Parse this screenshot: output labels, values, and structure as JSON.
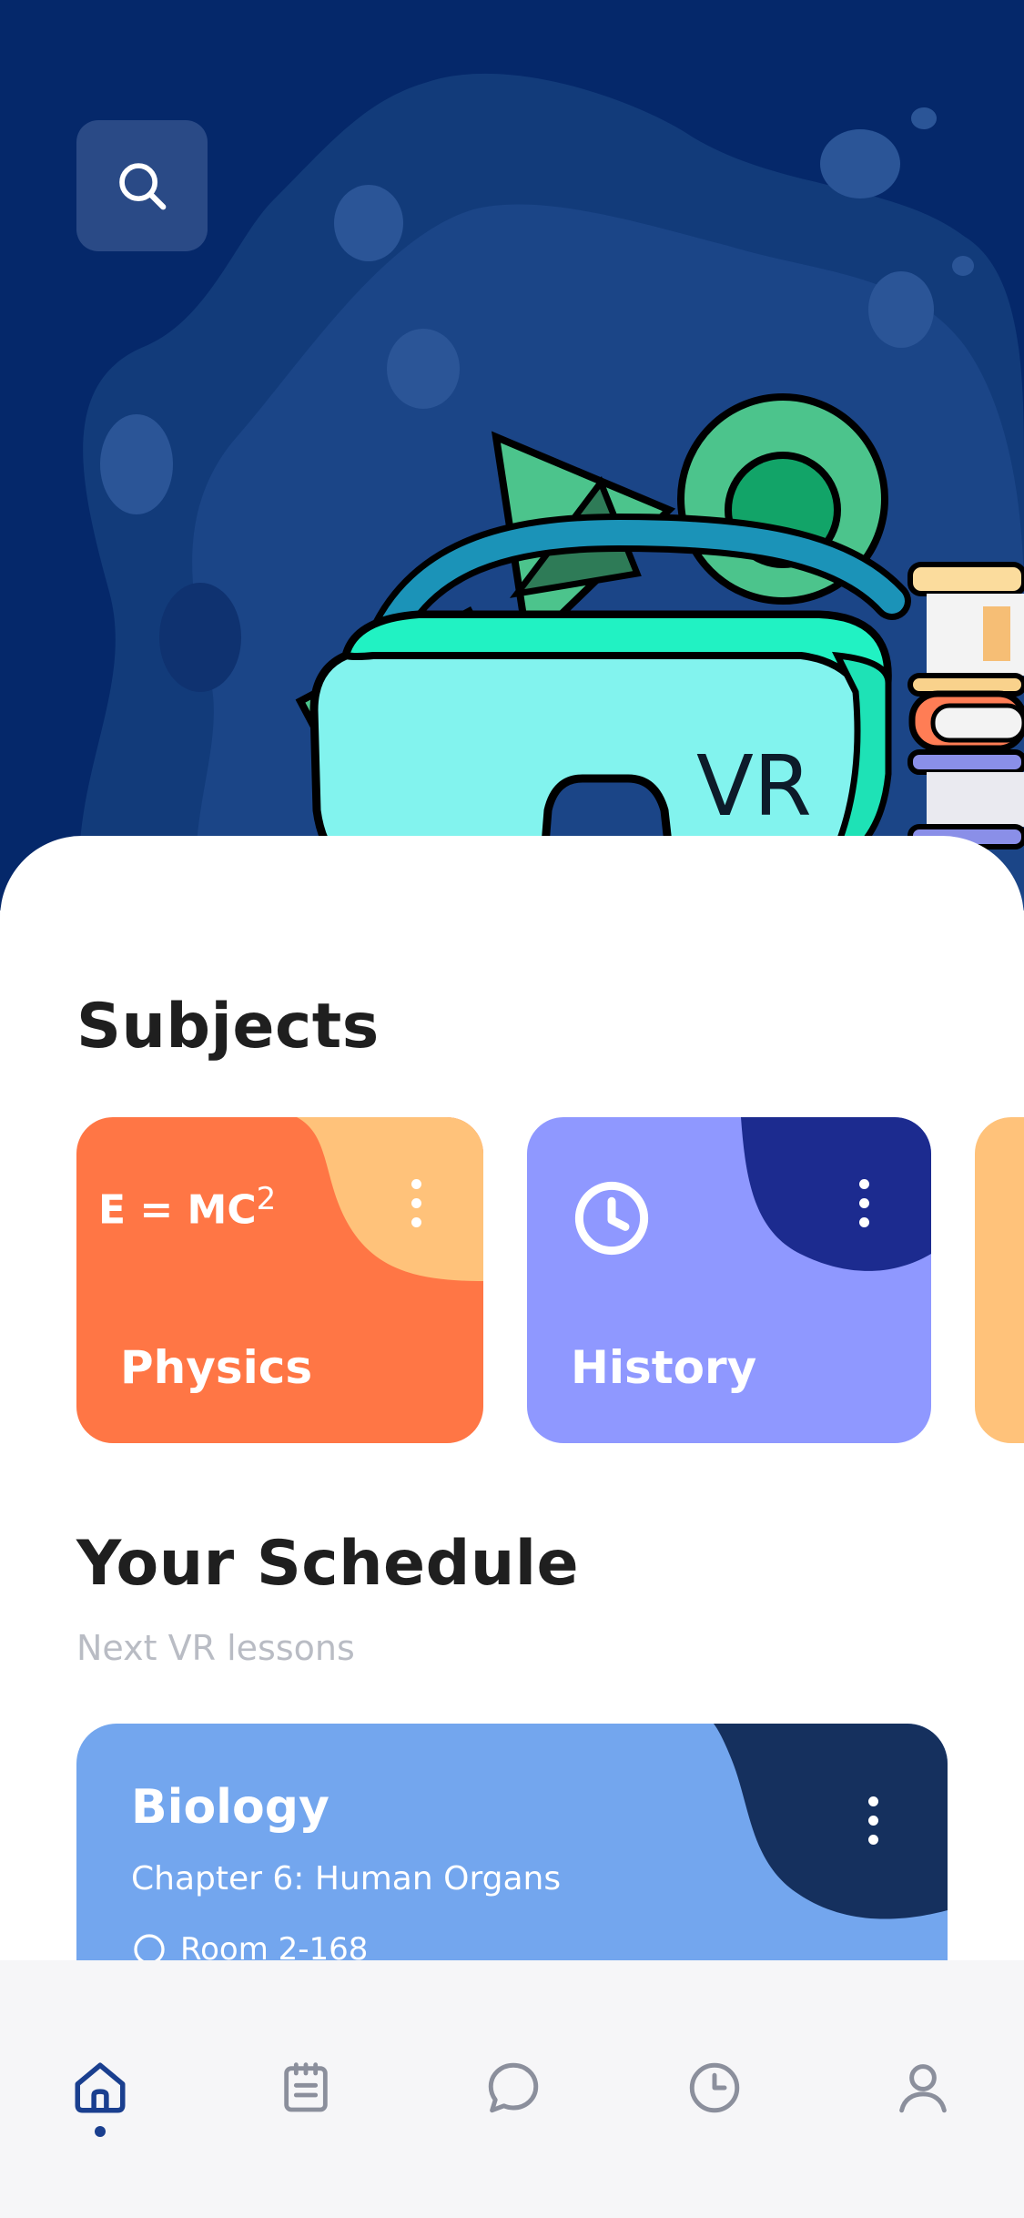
{
  "header": {
    "search_icon": "search-icon"
  },
  "subjects": {
    "heading": "Subjects",
    "cards": [
      {
        "label": "Physics",
        "formula": "E = MC",
        "formula_power": "2",
        "color": "#FF7645",
        "accent": "#FFC27A"
      },
      {
        "label": "History",
        "icon": "clock-icon",
        "color": "#8F98FF",
        "accent": "#1C2B8F"
      }
    ]
  },
  "schedule": {
    "heading": "Your Schedule",
    "subheading": "Next VR lessons",
    "lesson": {
      "title": "Biology",
      "chapter": "Chapter 6: Human Organs",
      "room": "Room 2-168"
    }
  },
  "nav": {
    "items": [
      "home-icon",
      "calendar-icon",
      "chat-icon",
      "history-icon",
      "profile-icon"
    ],
    "active": "home-icon"
  },
  "colors": {
    "hero": "#05286A",
    "accent_blue": "#73A6EE",
    "dark_navy": "#15305E"
  }
}
